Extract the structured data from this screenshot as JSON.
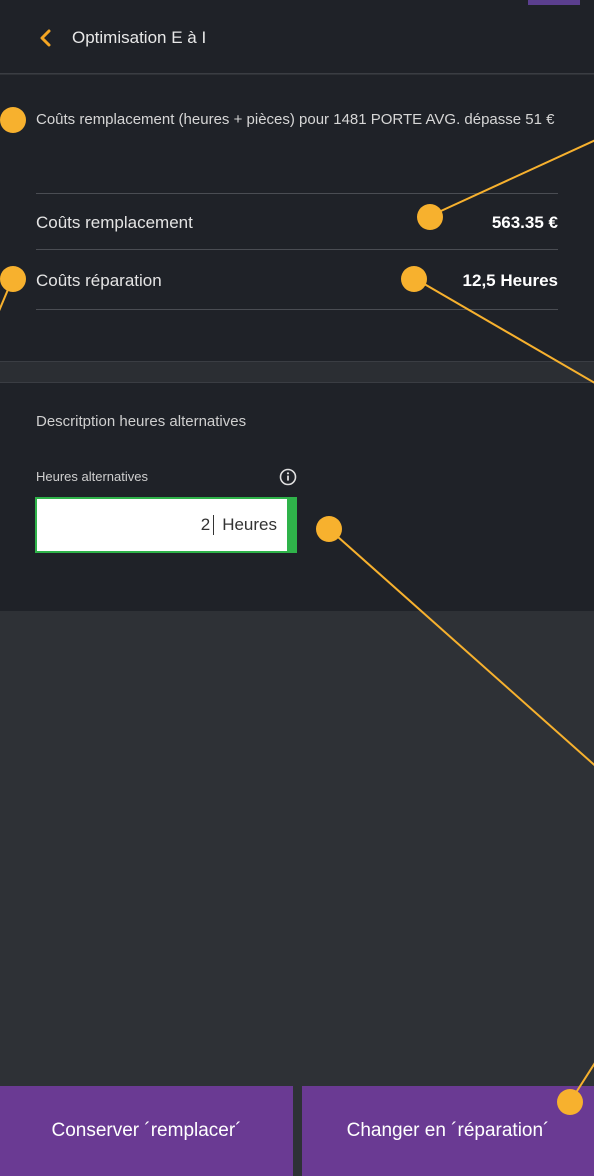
{
  "header": {
    "title": "Optimisation E à I",
    "back_icon": "chevron-left-icon",
    "accent_color": "#f5a623"
  },
  "cost": {
    "intro": "Coûts remplacement (heures + pièces) pour 1481 PORTE AVG. dépasse 51  €",
    "rows": [
      {
        "label": "Coûts remplacement",
        "value": "563.35  €"
      },
      {
        "label": "Coûts réparation",
        "value": "12,5 Heures"
      }
    ]
  },
  "alt_hours": {
    "description": "Descritption heures alternatives",
    "field_label": "Heures alternatives",
    "info_icon": "info-circle-icon",
    "value": "2",
    "unit": "Heures",
    "focus_color": "#2fb34a"
  },
  "actions": {
    "keep": "Conserver ´remplacer´",
    "change": "Changer en ´réparation´",
    "button_color": "#6a3a93"
  },
  "annotation_color": "#f7b12e"
}
